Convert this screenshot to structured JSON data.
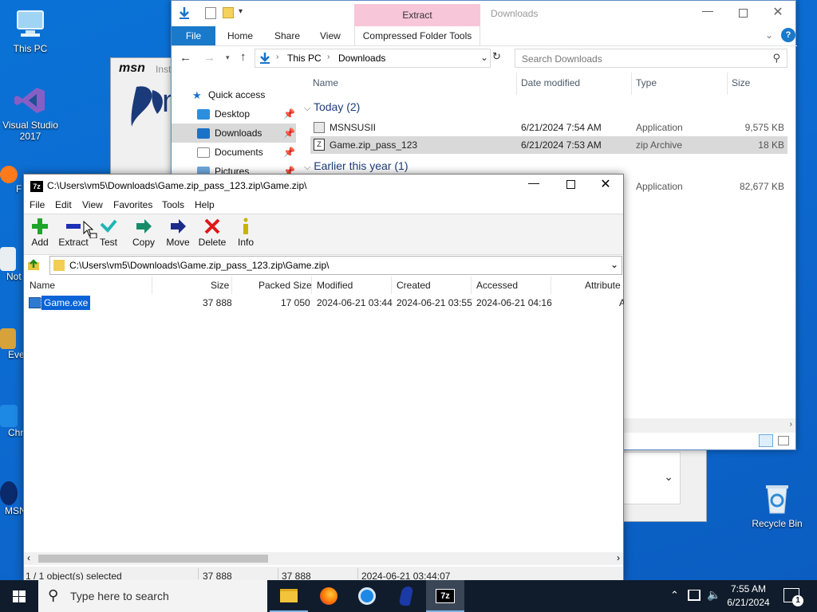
{
  "desktop": {
    "icons": [
      {
        "label": "This PC"
      },
      {
        "label": "Visual Studio 2017"
      },
      {
        "label": "Recycle Bin"
      }
    ],
    "edge_labels": [
      "F",
      "Not",
      "Eve",
      "Chr",
      "MSN"
    ]
  },
  "msn": {
    "logo": "msn",
    "tag": "Inst"
  },
  "explorer": {
    "title": "Downloads",
    "contextual_tab": "Extract",
    "tabs": [
      "File",
      "Home",
      "Share",
      "View",
      "Compressed Folder Tools"
    ],
    "breadcrumb": [
      "This PC",
      "Downloads"
    ],
    "search_placeholder": "Search Downloads",
    "columns": {
      "name": "Name",
      "date": "Date modified",
      "type": "Type",
      "size": "Size"
    },
    "nav": [
      "Quick access",
      "Desktop",
      "Downloads",
      "Documents",
      "Pictures"
    ],
    "groups": {
      "today": "Today (2)",
      "earlier": "Earlier this year (1)"
    },
    "files": [
      {
        "name": "MSNSUSII",
        "date": "6/21/2024 7:54 AM",
        "type": "Application",
        "size": "9,575 KB"
      },
      {
        "name": "Game.zip_pass_123",
        "date": "6/21/2024 7:53 AM",
        "type": "zip Archive",
        "size": "18 KB"
      },
      {
        "name": "",
        "date": "",
        "type": "Application",
        "size": "82,677 KB"
      }
    ]
  },
  "sevenzip": {
    "title": "C:\\Users\\vm5\\Downloads\\Game.zip_pass_123.zip\\Game.zip\\",
    "menu": [
      "File",
      "Edit",
      "View",
      "Favorites",
      "Tools",
      "Help"
    ],
    "tools": [
      "Add",
      "Extract",
      "Test",
      "Copy",
      "Move",
      "Delete",
      "Info"
    ],
    "path": "C:\\Users\\vm5\\Downloads\\Game.zip_pass_123.zip\\Game.zip\\",
    "columns": [
      "Name",
      "Size",
      "Packed Size",
      "Modified",
      "Created",
      "Accessed",
      "Attribute"
    ],
    "row": {
      "name": "Game.exe",
      "size": "37 888",
      "packed": "17 050",
      "modified": "2024-06-21 03:44",
      "created": "2024-06-21 03:55",
      "accessed": "2024-06-21 04:16",
      "attr": "A"
    },
    "status": {
      "selected": "1 / 1 object(s) selected",
      "size": "37 888",
      "packed": "37 888",
      "date": "2024-06-21 03:44:07"
    }
  },
  "taskbar": {
    "search_placeholder": "Type here to search",
    "time": "7:55 AM",
    "date": "6/21/2024",
    "notification_count": "1"
  },
  "colors": {
    "accent": "#0078d7",
    "selection": "#cce8ff",
    "taskbar": "#101c2c",
    "ribbon_extract": "#f7c6d9"
  }
}
